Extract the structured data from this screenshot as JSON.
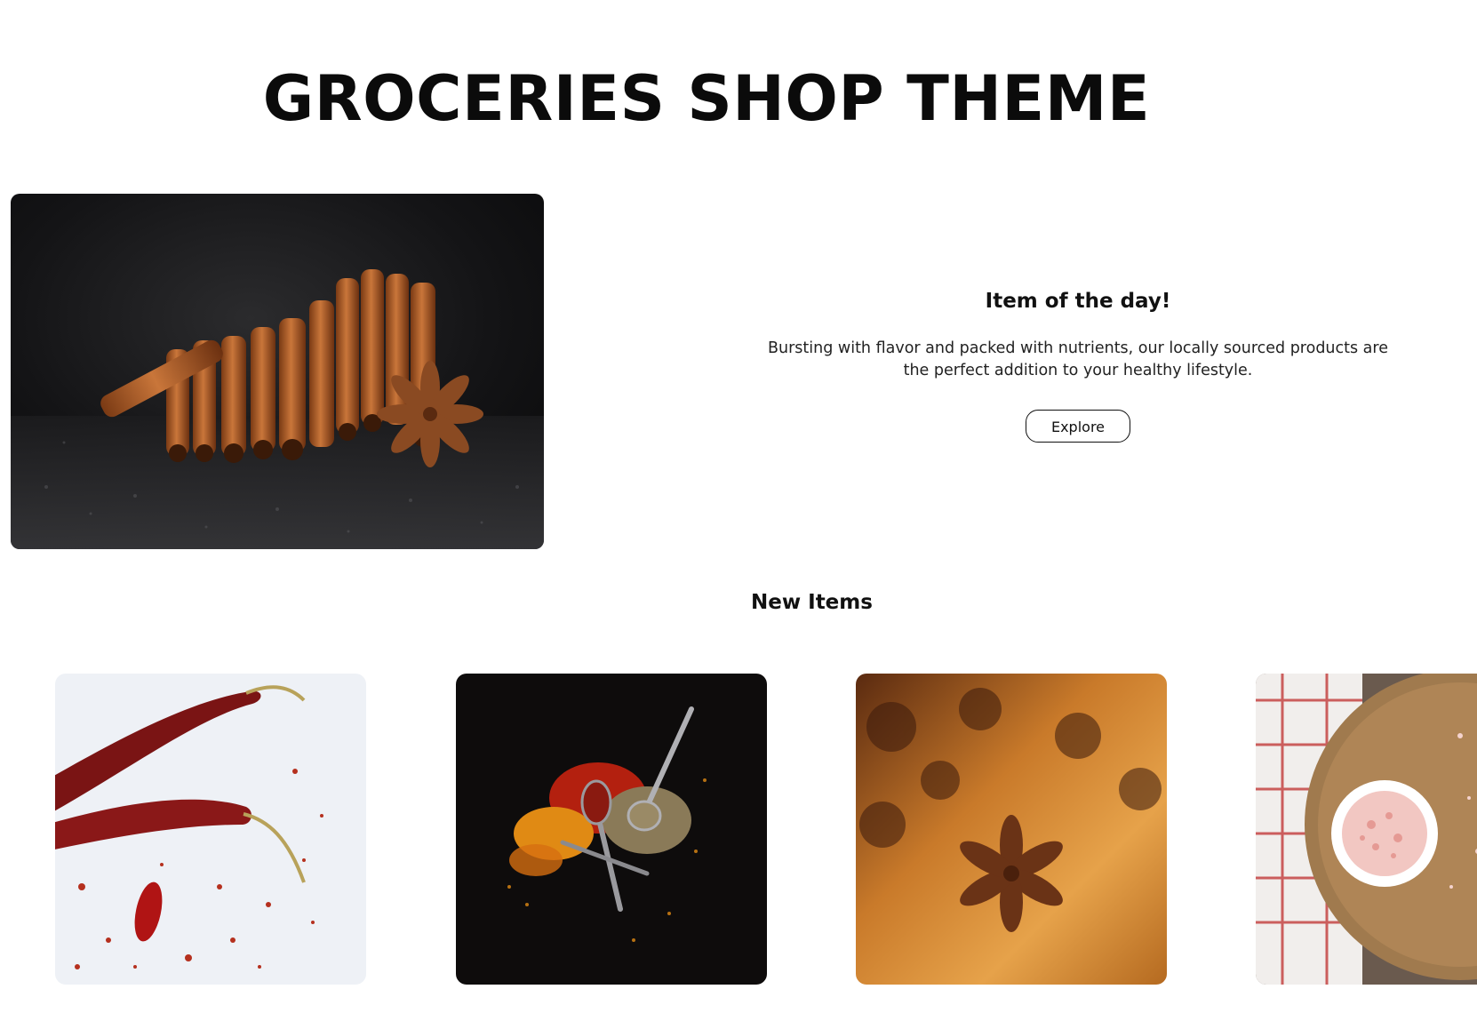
{
  "header": {
    "title": "GROCERIES SHOP THEME"
  },
  "hero": {
    "image": "cinnamon-sticks-star-anise-photo",
    "heading": "Item of the day!",
    "description": "Bursting with flavor and packed with nutrients, our locally sourced products are the perfect addition to your healthy lifestyle.",
    "button_label": "Explore"
  },
  "new_items": {
    "title": "New Items",
    "items": [
      {
        "image": "dried-red-chili-peppers-photo"
      },
      {
        "image": "spice-powders-with-spoons-photo"
      },
      {
        "image": "star-anise-on-wood-photo"
      },
      {
        "image": "pink-salt-in-bowl-photo"
      }
    ]
  },
  "colors": {
    "background": "#ffffff",
    "text": "#111111",
    "button_border": "#111111"
  }
}
